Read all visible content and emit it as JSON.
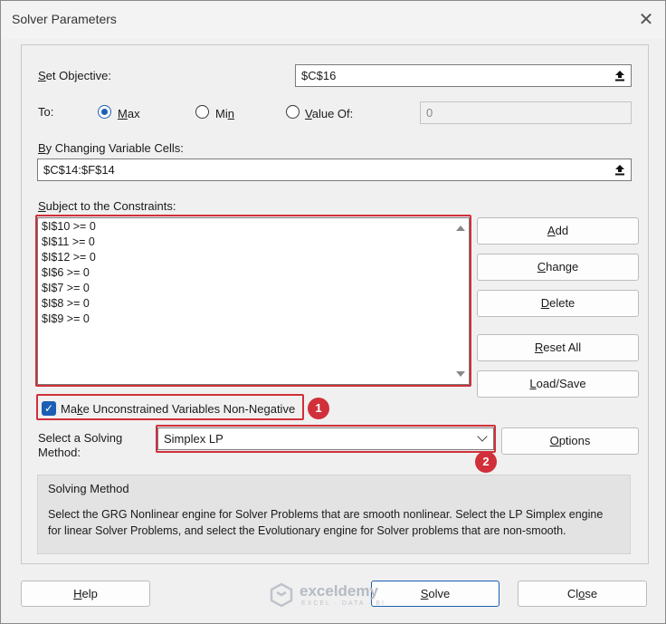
{
  "window": {
    "title": "Solver Parameters",
    "close_glyph": "✕"
  },
  "objective": {
    "label_prefix": "S",
    "label_rest": "et Objective:",
    "value": "$C$16"
  },
  "to": {
    "label": "To:",
    "max_prefix": "M",
    "max_rest": "ax",
    "min_prefix": "Mi",
    "min_underline": "n",
    "valueof_prefix": "V",
    "valueof_rest": "alue Of:",
    "value_of": "0",
    "selected": "max"
  },
  "changing": {
    "label_prefix": "B",
    "label_rest": "y Changing Variable Cells:",
    "value": "$C$14:$F$14"
  },
  "constraints": {
    "label_prefix": "S",
    "label_underline": "u",
    "label_rest": "bject to the Constraints:",
    "items": [
      "$I$10 >= 0",
      "$I$11 >= 0",
      "$I$12 >= 0",
      "$I$6 >= 0",
      "$I$7 >= 0",
      "$I$8 >= 0",
      "$I$9 >= 0"
    ]
  },
  "side_buttons": {
    "add_u": "A",
    "add_rest": "dd",
    "change_u": "C",
    "change_rest": "hange",
    "delete_u": "D",
    "delete_rest": "elete",
    "reset_u": "R",
    "reset_rest": "eset All",
    "load_u": "L",
    "load_rest": "oad/Save"
  },
  "nonneg": {
    "label_prefix": "Ma",
    "label_underline": "k",
    "label_rest": "e Unconstrained Variables Non-Negative",
    "checked": true
  },
  "method": {
    "label_line1_a": "Select a Solvin",
    "label_line1_u": "g",
    "label_line2": "Method:",
    "selected": "Simplex LP",
    "options_u": "O",
    "options_rest": "ptions"
  },
  "solving_box": {
    "title": "Solving Method",
    "description": "Select the GRG Nonlinear engine for Solver Problems that are smooth nonlinear. Select the LP Simplex engine for linear Solver Problems, and select the Evolutionary engine for Solver problems that are non-smooth."
  },
  "badges": [
    "1",
    "2"
  ],
  "footer": {
    "help_u": "H",
    "help_rest": "elp",
    "solve_u": "S",
    "solve_rest": "olve",
    "close_pre": "Cl",
    "close_u": "o",
    "close_rest": "se"
  },
  "watermark": {
    "name": "exceldemy",
    "sub": "EXCEL · DATA · BI"
  },
  "colors": {
    "accent": "#1a5fb4",
    "highlight_red": "#d0303a"
  },
  "icons": {
    "collapse": "collapse-dialog-icon",
    "dropdown": "chevron-down-icon",
    "check": "checkmark-icon"
  }
}
